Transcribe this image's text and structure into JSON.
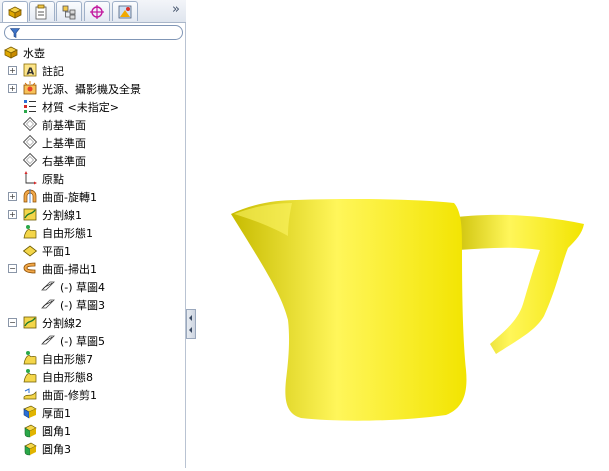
{
  "tabs": [
    {
      "icon": "feature-manager-icon",
      "active": true
    },
    {
      "icon": "property-manager-icon"
    },
    {
      "icon": "configuration-manager-icon"
    },
    {
      "icon": "dimxpert-icon"
    },
    {
      "icon": "display-manager-icon"
    }
  ],
  "more_label": "»",
  "tree": {
    "root": {
      "label": "水壺",
      "icon": "part-icon"
    },
    "items": [
      {
        "label": "註記",
        "icon": "annotations-icon",
        "expandable": true
      },
      {
        "label": "光源、攝影機及全景",
        "icon": "lights-icon",
        "expandable": true
      },
      {
        "label": "材質 <未指定>",
        "icon": "material-icon"
      },
      {
        "label": "前基準面",
        "icon": "plane-icon"
      },
      {
        "label": "上基準面",
        "icon": "plane-icon"
      },
      {
        "label": "右基準面",
        "icon": "plane-icon"
      },
      {
        "label": "原點",
        "icon": "origin-icon"
      },
      {
        "label": "曲面-旋轉1",
        "icon": "revolve-surface-icon",
        "expandable": true
      },
      {
        "label": "分割線1",
        "icon": "split-line-icon",
        "expandable": true
      },
      {
        "label": "自由形態1",
        "icon": "freeform-icon"
      },
      {
        "label": "平面1",
        "icon": "planar-surface-icon"
      },
      {
        "label": "曲面-掃出1",
        "icon": "sweep-surface-icon",
        "expanded": true
      },
      {
        "label": "(-) 草圖4",
        "icon": "sketch-icon",
        "child": true
      },
      {
        "label": "(-) 草圖3",
        "icon": "sketch-icon",
        "child": true
      },
      {
        "label": "分割線2",
        "icon": "split-line-icon",
        "expanded": true
      },
      {
        "label": "(-) 草圖5",
        "icon": "sketch-icon",
        "child": true
      },
      {
        "label": "自由形態7",
        "icon": "freeform-icon"
      },
      {
        "label": "自由形態8",
        "icon": "freeform-icon"
      },
      {
        "label": "曲面-修剪1",
        "icon": "trim-surface-icon"
      },
      {
        "label": "厚面1",
        "icon": "thicken-icon"
      },
      {
        "label": "圓角1",
        "icon": "fillet-icon"
      },
      {
        "label": "圓角3",
        "icon": "fillet-icon"
      }
    ]
  },
  "colors": {
    "model": "#f2e400",
    "model_light": "#fff65a",
    "model_dark": "#c7bb00"
  }
}
